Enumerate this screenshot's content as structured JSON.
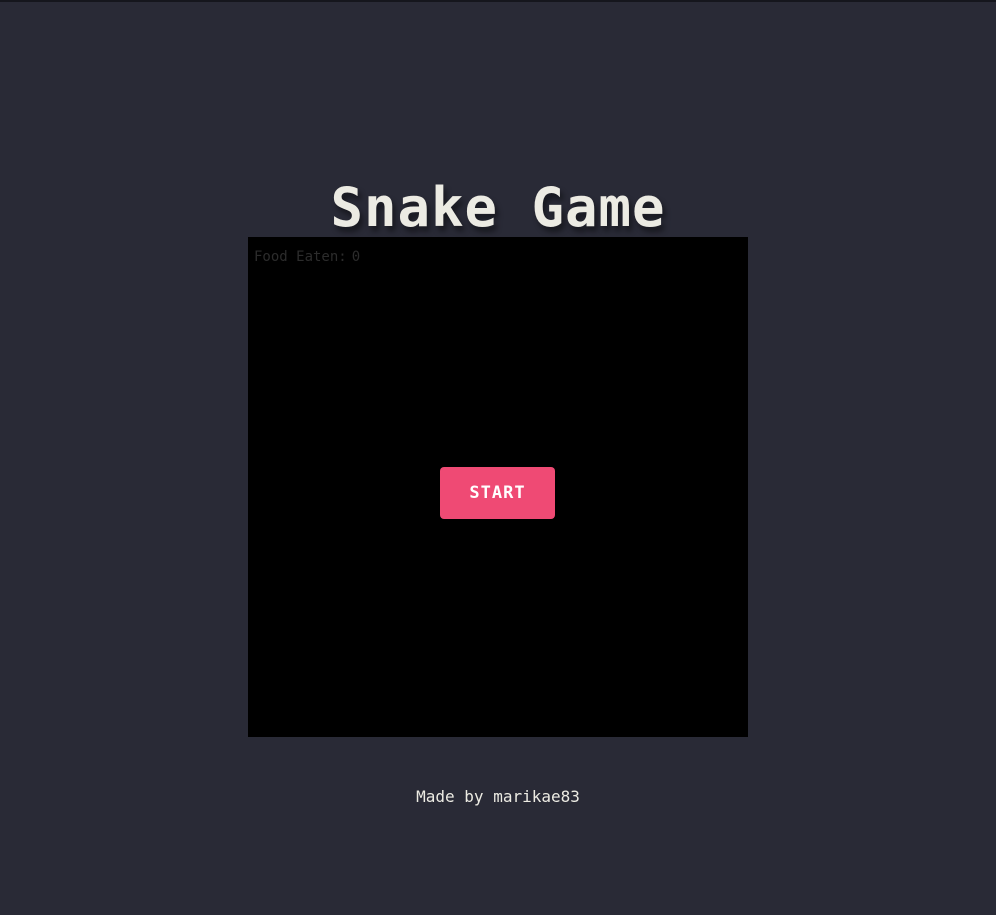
{
  "title": "Snake Game",
  "score": {
    "label": "Food Eaten:",
    "value": "0"
  },
  "start_button": {
    "label": "START"
  },
  "footer": {
    "prefix": "Made by",
    "author": "marikae83"
  },
  "colors": {
    "background": "#292a36",
    "board": "#000000",
    "accent": "#ef4a74",
    "text": "#ecebe3"
  }
}
